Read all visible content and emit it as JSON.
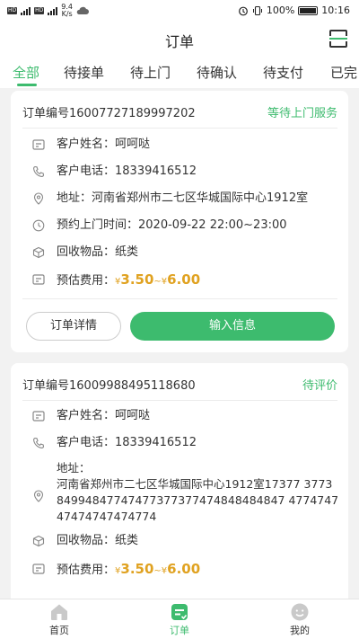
{
  "status_bar": {
    "left": "HD 4G 4G",
    "speed_value": "9.4",
    "speed_unit": "K/s",
    "battery": "100%",
    "time": "10:16"
  },
  "header": {
    "title": "订单",
    "action_icon": "scan-icon"
  },
  "tabs": [
    {
      "label": "全部",
      "active": true
    },
    {
      "label": "待接单"
    },
    {
      "label": "待上门"
    },
    {
      "label": "待确认"
    },
    {
      "label": "待支付"
    },
    {
      "label": "已完"
    }
  ],
  "orders": [
    {
      "order_no": "订单编号16007727189997202",
      "status": "等待上门服务",
      "customer_name_label": "客户姓名：",
      "customer_name": "呵呵哒",
      "customer_phone_label": "客户电话：",
      "customer_phone": "18339416512",
      "address_label": "地址：",
      "address": "河南省郑州市二七区华城国际中心1912室",
      "time_label": "预约上门时间：",
      "time": "2020-09-22 22:00~23:00",
      "items_label": "回收物品：",
      "items": "纸类",
      "fee_label": "预估费用：",
      "fee_min": "3.50",
      "fee_max": "6.00",
      "currency": "¥",
      "fee_sep": "~",
      "detail_button": "订单详情",
      "input_button": "输入信息"
    },
    {
      "order_no": "订单编号16009988495118680",
      "status": "待评价",
      "customer_name_label": "客户姓名：",
      "customer_name": "呵呵哒",
      "customer_phone_label": "客户电话：",
      "customer_phone": "18339416512",
      "address_label": "地址：",
      "address": "河南省郑州市二七区华城国际中心1912室17377 377384994847747477377377474848484847 477474747474747474774",
      "items_label": "回收物品：",
      "items": "纸类",
      "fee_label": "预估费用：",
      "fee_min": "3.50",
      "fee_max": "6.00",
      "currency": "¥",
      "fee_sep": "~"
    }
  ],
  "bottom_nav": [
    {
      "label": "首页",
      "icon": "home-icon"
    },
    {
      "label": "订单",
      "icon": "order-icon",
      "active": true
    },
    {
      "label": "我的",
      "icon": "profile-icon"
    }
  ],
  "colors": {
    "accent": "#3dbb6e",
    "price": "#e0a221",
    "background": "#f2f2f2"
  }
}
